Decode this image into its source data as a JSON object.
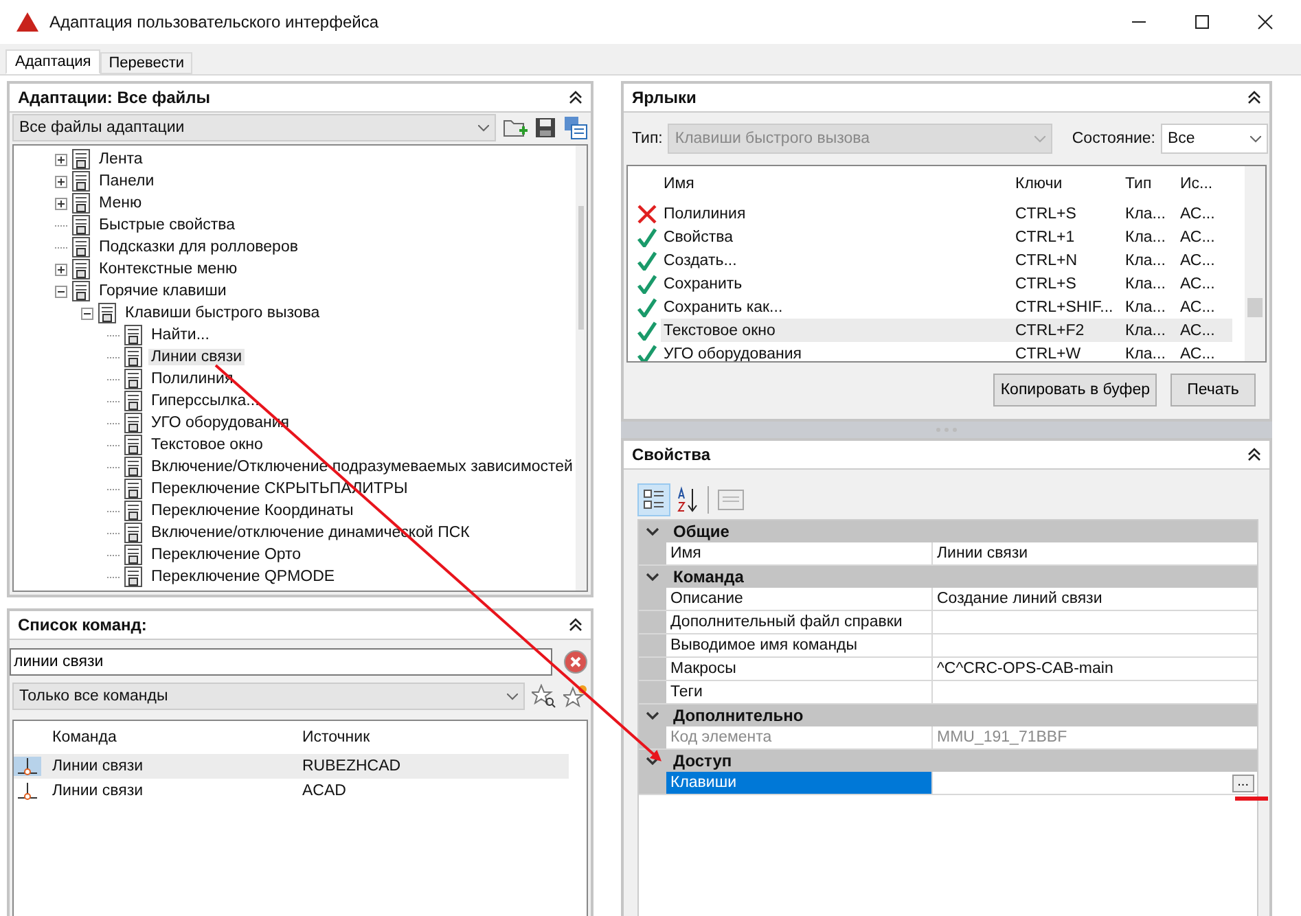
{
  "window": {
    "title": "Адаптация пользовательского интерфейса"
  },
  "tabs": [
    {
      "label": "Адаптация",
      "selected": true
    },
    {
      "label": "Перевести",
      "selected": false
    }
  ],
  "customizations": {
    "title": "Адаптации: Все файлы",
    "file_select": "Все файлы адаптации",
    "tree": [
      {
        "label": "Лента",
        "kind": "branch",
        "expanded": false,
        "selected": false
      },
      {
        "label": "Панели",
        "kind": "branch",
        "expanded": false,
        "selected": false
      },
      {
        "label": "Меню",
        "kind": "branch",
        "expanded": false,
        "selected": false
      },
      {
        "label": "Быстрые свойства",
        "kind": "leaf",
        "selected": false
      },
      {
        "label": "Подсказки для ролловеров",
        "kind": "leaf",
        "selected": false
      },
      {
        "label": "Контекстные меню",
        "kind": "branch",
        "expanded": false,
        "selected": false
      },
      {
        "label": "Горячие клавиши",
        "kind": "branch",
        "expanded": true,
        "selected": false,
        "children": [
          {
            "label": "Клавиши быстрого вызова",
            "kind": "branch",
            "expanded": true,
            "selected": false,
            "children": [
              {
                "label": "Найти...",
                "kind": "leaf",
                "selected": false
              },
              {
                "label": "Линии связи",
                "kind": "leaf",
                "selected": true
              },
              {
                "label": "Полилиния",
                "kind": "leaf",
                "selected": false
              },
              {
                "label": "Гиперссылка...",
                "kind": "leaf",
                "selected": false
              },
              {
                "label": "УГО оборудования",
                "kind": "leaf",
                "selected": false
              },
              {
                "label": "Текстовое окно",
                "kind": "leaf",
                "selected": false
              },
              {
                "label": "Включение/Отключение подразумеваемых зависимостей",
                "kind": "leaf",
                "selected": false
              },
              {
                "label": "Переключение СКРЫТЬПАЛИТРЫ",
                "kind": "leaf",
                "selected": false
              },
              {
                "label": "Переключение Координаты",
                "kind": "leaf",
                "selected": false
              },
              {
                "label": "Включение/отключение динамической ПСК",
                "kind": "leaf",
                "selected": false
              },
              {
                "label": "Переключение Орто",
                "kind": "leaf",
                "selected": false
              },
              {
                "label": "Переключение QPMODE",
                "kind": "leaf",
                "selected": false
              }
            ]
          }
        ]
      }
    ]
  },
  "command_list": {
    "title": "Список команд:",
    "search": "линии связи",
    "filter": "Только все команды",
    "columns": [
      "Команда",
      "Источник"
    ],
    "rows": [
      {
        "command": "Линии связи",
        "source": "RUBEZHCAD",
        "selected": true
      },
      {
        "command": "Линии связи",
        "source": "ACAD",
        "selected": false
      }
    ]
  },
  "shortcuts": {
    "title": "Ярлыки",
    "type_label": "Тип:",
    "type_value": "Клавиши быстрого вызова",
    "type_disabled": true,
    "state_label": "Состояние:",
    "state_value": "Все",
    "columns": [
      "Имя",
      "Ключи",
      "Тип",
      "Ис..."
    ],
    "rows": [
      {
        "kind": "conflict",
        "name": "Полилиния",
        "keys": "CTRL+S",
        "type": "Кла...",
        "source": "АС...",
        "selected": false
      },
      {
        "kind": "ok",
        "name": "Свойства",
        "keys": "CTRL+1",
        "type": "Кла...",
        "source": "АС...",
        "selected": false
      },
      {
        "kind": "ok",
        "name": "Создать...",
        "keys": "CTRL+N",
        "type": "Кла...",
        "source": "АС...",
        "selected": false
      },
      {
        "kind": "ok",
        "name": "Сохранить",
        "keys": "CTRL+S",
        "type": "Кла...",
        "source": "АС...",
        "selected": false
      },
      {
        "kind": "ok",
        "name": "Сохранить как...",
        "keys": "CTRL+SHIF...",
        "type": "Кла...",
        "source": "АС...",
        "selected": false
      },
      {
        "kind": "ok",
        "name": "Текстовое окно",
        "keys": "CTRL+F2",
        "type": "Кла...",
        "source": "АС...",
        "selected": true
      },
      {
        "kind": "ok",
        "name": "УГО оборудования",
        "keys": "CTRL+W",
        "type": "Кла...",
        "source": "АС...",
        "selected": false
      }
    ],
    "buttons": [
      "Копировать в буфер",
      "Печать"
    ]
  },
  "properties": {
    "title": "Свойства",
    "categories": [
      {
        "name": "Общие",
        "expanded": true,
        "rows": [
          {
            "name": "Имя",
            "value": "Линии связи",
            "selected": false,
            "disabled": false
          }
        ]
      },
      {
        "name": "Команда",
        "expanded": true,
        "rows": [
          {
            "name": "Описание",
            "value": "Создание линий связи",
            "selected": false,
            "disabled": false
          },
          {
            "name": "Дополнительный файл справки",
            "selected": false,
            "disabled": false
          },
          {
            "name": "Выводимое имя команды",
            "selected": false,
            "disabled": false
          },
          {
            "name": "Макросы",
            "value": "^C^CRC-OPS-CAB-main",
            "selected": false,
            "disabled": false
          },
          {
            "name": "Теги",
            "selected": false,
            "disabled": false
          }
        ]
      },
      {
        "name": "Дополнительно",
        "expanded": true,
        "rows": [
          {
            "name": "Код элемента",
            "value": "MMU_191_71BBF",
            "selected": false,
            "disabled": true
          }
        ]
      },
      {
        "name": "Доступ",
        "expanded": true,
        "rows": [
          {
            "name": "Клавиши",
            "selected": true,
            "disabled": false,
            "browse": "..."
          }
        ]
      }
    ]
  }
}
